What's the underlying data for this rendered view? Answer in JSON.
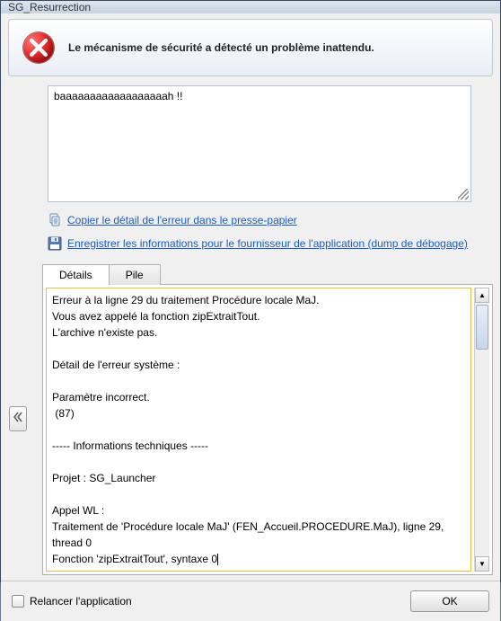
{
  "window": {
    "title": "SG_Resurrection"
  },
  "header": {
    "message": "Le mécanisme de sécurité a détecté un problème inattendu."
  },
  "user_message": "baaaaaaaaaaaaaaaaaah !!",
  "links": {
    "copy": "Copier le détail de l'erreur dans le presse-papier",
    "save": "Enregistrer les informations pour le fournisseur de l'application (dump de débogage)"
  },
  "tabs": {
    "details": "Détails",
    "stack": "Pile",
    "active": "details"
  },
  "details_text": "Erreur à la ligne 29 du traitement Procédure locale MaJ.\nVous avez appelé la fonction zipExtraitTout.\nL'archive n'existe pas.\n\nDétail de l'erreur système :\n\nParamètre incorrect.\n (87)\n\n----- Informations techniques -----\n\nProjet : SG_Launcher\n\nAppel WL :\nTraitement de 'Procédure locale MaJ' (FEN_Accueil.PROCEDURE.MaJ), ligne 29, thread 0\nFonction 'zipExtraitTout', syntaxe 0",
  "footer": {
    "relaunch_label": "Relancer l'application",
    "relaunch_checked": false,
    "ok_label": "OK"
  },
  "icons": {
    "error": "error-circle-x",
    "copy": "copy-icon",
    "save": "save-disk-icon",
    "expand": "double-chevron-left"
  },
  "chart_data": null
}
